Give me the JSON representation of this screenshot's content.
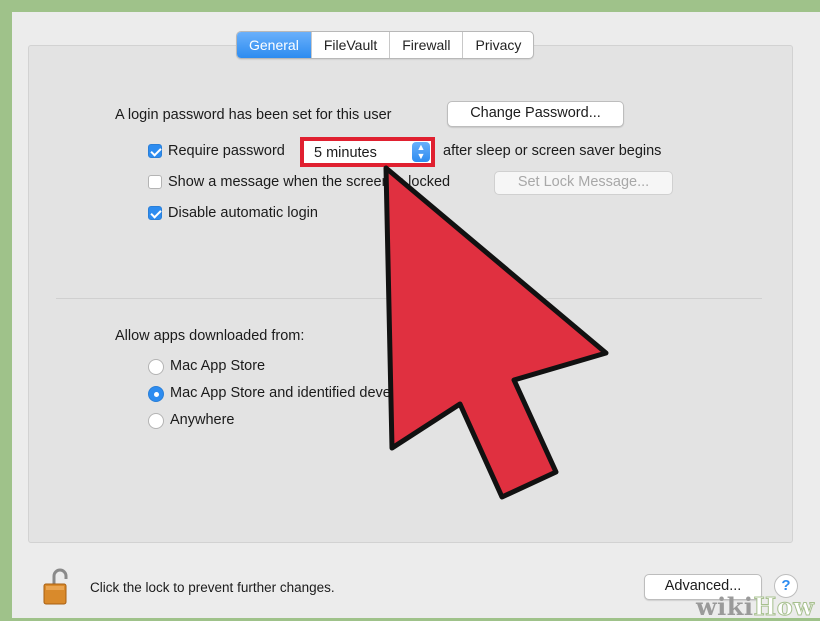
{
  "tabs": [
    "General",
    "FileVault",
    "Firewall",
    "Privacy"
  ],
  "login": {
    "password_text": "A login password has been set for this user",
    "change_password_label": "Change Password...",
    "require_password_label": "Require password",
    "require_password_checked": true,
    "require_password_delay": "5 minutes",
    "after_sleep_text": "after sleep or screen saver begins",
    "show_message_label": "Show a message when the screen is locked",
    "show_message_checked": false,
    "set_lock_message_label": "Set Lock Message...",
    "disable_auto_login_label": "Disable automatic login",
    "disable_auto_login_checked": true
  },
  "apps": {
    "heading": "Allow apps downloaded from:",
    "options": [
      "Mac App Store",
      "Mac App Store and identified developers",
      "Anywhere"
    ],
    "selected_index": 1
  },
  "footer": {
    "lock_text": "Click the lock to prevent further changes.",
    "advanced_label": "Advanced...",
    "help_label": "?"
  },
  "watermark": {
    "part1": "wiki",
    "part2": "How"
  },
  "colors": {
    "accent": "#2d8cf0",
    "highlight": "#e02030",
    "arrow": "#e03040"
  },
  "icons": {
    "lock": "open-padlock-icon",
    "arrow": "pointer-arrow-icon",
    "help": "question-icon"
  }
}
